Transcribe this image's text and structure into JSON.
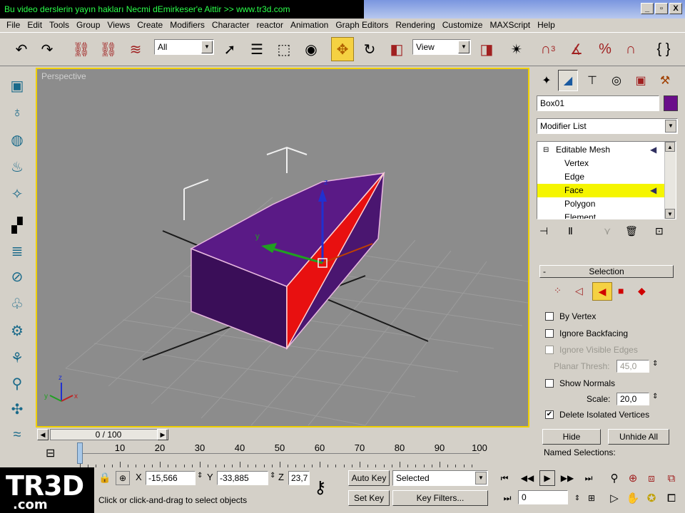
{
  "title_bar": {
    "caption": "Bu video derslerin yayın hakları Necmi dEmirkeser'e Aittir >> www.tr3d.com",
    "buttons": [
      "_",
      "▫",
      "X"
    ]
  },
  "menu": [
    "File",
    "Edit",
    "Tools",
    "Group",
    "Views",
    "Create",
    "Modifiers",
    "Character",
    "reactor",
    "Animation",
    "Graph Editors",
    "Rendering",
    "Customize",
    "MAXScript",
    "Help"
  ],
  "toolbar": {
    "selection_filter": "All",
    "reference_coord": "View",
    "snap_label": "3"
  },
  "viewport": {
    "label": "Perspective",
    "gizmo_axes": {
      "x": "x",
      "y": "y",
      "z": "z"
    },
    "colors": {
      "background": "#8c8c8c",
      "object": "#4a1a6e",
      "selected_face": "#e81010",
      "border": "#f0d000"
    }
  },
  "time_slider": {
    "position": "0 / 100",
    "current_frame": 0,
    "total_frames": 100
  },
  "track_bar": {
    "ticks": [
      "0",
      "10",
      "20",
      "30",
      "40",
      "50",
      "60",
      "70",
      "80",
      "90",
      "100"
    ]
  },
  "status": {
    "x_label": "X",
    "y_label": "Y",
    "z_label": "Z",
    "x_value": "-15,566",
    "y_value": "-33,885",
    "z_value": "23,7",
    "prompt": "Click or click-and-drag to select objects",
    "auto_key": "Auto Key",
    "set_key": "Set Key",
    "key_mode": "Selected",
    "key_filters": "Key Filters...",
    "frame_field": "0"
  },
  "logo": {
    "main": "TR3D",
    "sub": ".com"
  },
  "command_panel": {
    "object_name": "Box01",
    "object_color": "#6a0e8a",
    "modifier_list": "Modifier List",
    "stack": [
      {
        "label": "Editable Mesh",
        "level": 0,
        "selected": false
      },
      {
        "label": "Vertex",
        "level": 1,
        "selected": false
      },
      {
        "label": "Edge",
        "level": 1,
        "selected": false
      },
      {
        "label": "Face",
        "level": 1,
        "selected": true
      },
      {
        "label": "Polygon",
        "level": 1,
        "selected": false
      },
      {
        "label": "Element",
        "level": 1,
        "selected": false
      }
    ],
    "selection_rollout": {
      "title": "Selection",
      "collapse_symbol": "-",
      "by_vertex": {
        "label": "By Vertex",
        "checked": false
      },
      "ignore_backfacing": {
        "label": "Ignore Backfacing",
        "checked": false
      },
      "ignore_visible_edges": {
        "label": "Ignore Visible Edges",
        "checked": false,
        "disabled": true
      },
      "planar_thresh_label": "Planar Thresh:",
      "planar_thresh_value": "45,0",
      "show_normals": {
        "label": "Show Normals",
        "checked": false
      },
      "scale_label": "Scale:",
      "scale_value": "20,0",
      "delete_isolated": {
        "label": "Delete Isolated Vertices",
        "checked": true
      },
      "hide_button": "Hide",
      "unhide_all_button": "Unhide All",
      "named_selections": "Named Selections:"
    }
  }
}
